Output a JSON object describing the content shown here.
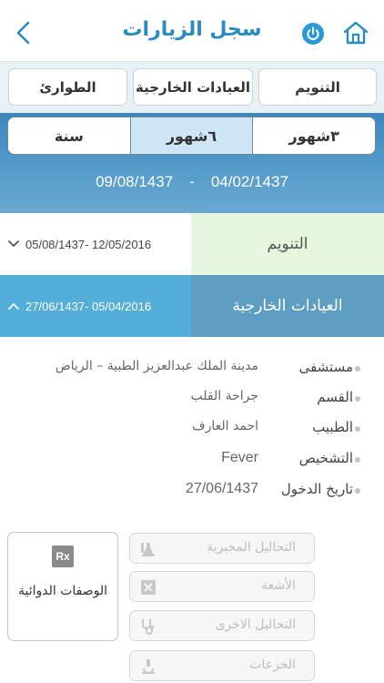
{
  "header": {
    "title": "سجل الزيارات"
  },
  "visit_types": [
    "الطوارئ",
    "العيادات الخارجية",
    "التنويم"
  ],
  "periods": [
    "سنة",
    "٦شهور",
    "٣شهور"
  ],
  "active_period": "٦شهور",
  "date_range": {
    "from": "04/02/1437",
    "separator": "-",
    "to": "09/08/1437"
  },
  "categories": [
    {
      "name": "التنويم",
      "range": "05/08/1437- 12/05/2016",
      "expanded": false
    },
    {
      "name": "العيادات الخارجية",
      "range": "27/06/1437- 05/04/2016",
      "expanded": true
    }
  ],
  "visit": {
    "fields": [
      {
        "label": "مستشفى",
        "value": "مدينة الملك عبدالعزيز الطبية – الرياض"
      },
      {
        "label": "القسم",
        "value": "جراحة القلب"
      },
      {
        "label": "الطبيب",
        "value": "احمد العارف"
      },
      {
        "label": "التشخيص",
        "value": "Fever"
      },
      {
        "label": "تاريخ الدخول",
        "value": "27/06/1437"
      }
    ]
  },
  "prescriptions": {
    "icon": "rx-icon",
    "icon_text": "Rx",
    "label": "الوصفات الدوائية"
  },
  "actions": [
    {
      "label": "التحاليل المخبرية",
      "icon": "lab-flask-icon"
    },
    {
      "label": "الأشعة",
      "icon": "xray-icon"
    },
    {
      "label": "التحاليل الاخرى",
      "icon": "stethoscope-icon"
    },
    {
      "label": "الخزعات",
      "icon": "microscope-icon"
    }
  ],
  "colors": {
    "accent": "#2a8bbf",
    "banner": "#4f98c8",
    "inpatient_row": "#e6f6df",
    "outpatient_row": "#5d9ec2",
    "outpatient_range": "#53aed9"
  }
}
